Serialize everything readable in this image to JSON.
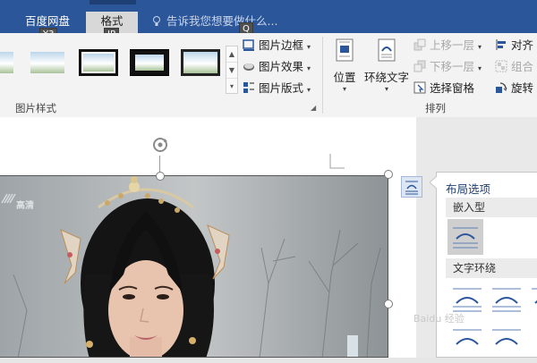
{
  "tabs": {
    "baidu": "百度网盘",
    "format": "格式",
    "tell_me": "告诉我您想要做什么..."
  },
  "keytips": {
    "baidu": "Y3",
    "format": "JP",
    "tell_me": "Q"
  },
  "ribbon": {
    "picture_styles_label": "图片样式",
    "picture_border": "图片边框",
    "picture_effects": "图片效果",
    "picture_layout": "图片版式",
    "position": "位置",
    "wrap_text": "环绕文字",
    "bring_forward": "上移一层",
    "send_backward": "下移一层",
    "selection_pane": "选择窗格",
    "align": "对齐",
    "group": "组合",
    "rotate": "旋转",
    "arrange_label": "排列"
  },
  "layout_panel": {
    "title": "布局选项",
    "inline_section": "嵌入型",
    "wrap_section": "文字环绕"
  },
  "photo": {
    "channel_tag": "高清"
  },
  "watermark": "Baidu 经验",
  "colors": {
    "accent": "#2b579a",
    "panel_title": "#1f3f73"
  }
}
